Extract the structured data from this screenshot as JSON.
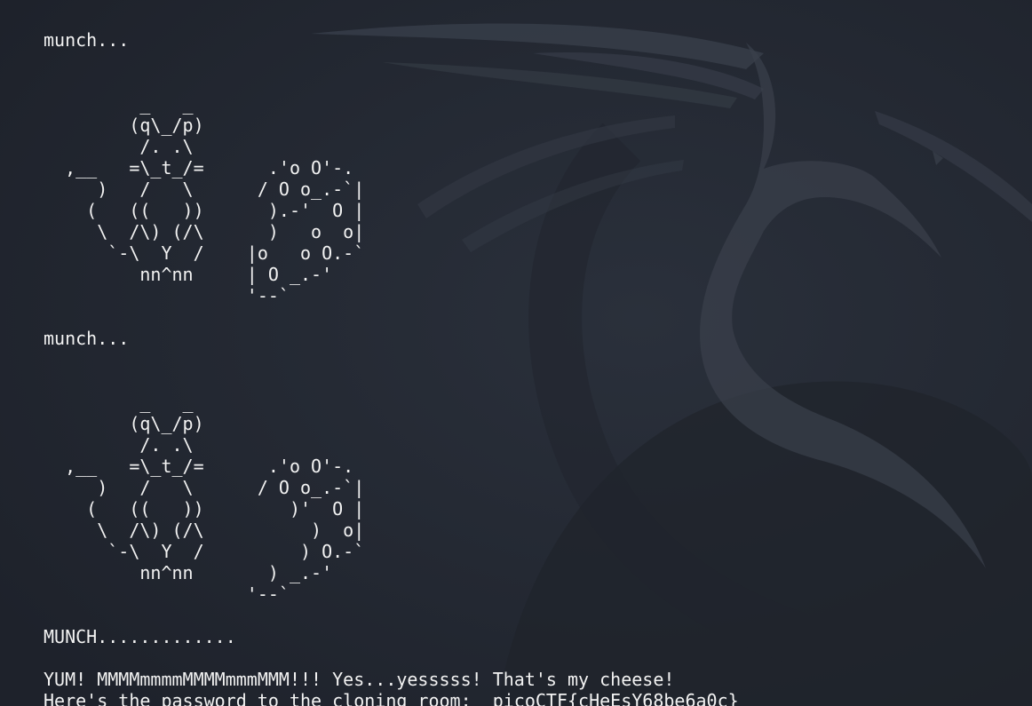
{
  "terminal": {
    "lines": [
      "munch...",
      "",
      "",
      "         _   _",
      "        (q\\_/p)",
      "         /. .\\",
      "  ,__   =\\_t_/=      .'o O'-.",
      "     )   /   \\      / O o_.-`|",
      "    (   ((   ))      ).-'  O |",
      "     \\  /\\) (/\\      )   o  o|",
      "      `-\\  Y  /    |o   o O.-`",
      "         nn^nn     | O _.-'",
      "                   '--`",
      "",
      "munch...",
      "",
      "",
      "         _   _",
      "        (q\\_/p)",
      "         /. .\\",
      "  ,__   =\\_t_/=      .'o O'-.",
      "     )   /   \\      / O o_.-`|",
      "    (   ((   ))        )'  O |",
      "     \\  /\\) (/\\          )  o|",
      "      `-\\  Y  /         ) O.-`",
      "         nn^nn       ) _.-'",
      "                   '--`",
      "",
      "MUNCH.............",
      "",
      "YUM! MMMMmmmmMMMMmmmMMM!!! Yes...yesssss! That's my cheese!",
      "Here's the password to the cloning room:  picoCTF{cHeEsY68be6a0c}"
    ]
  }
}
